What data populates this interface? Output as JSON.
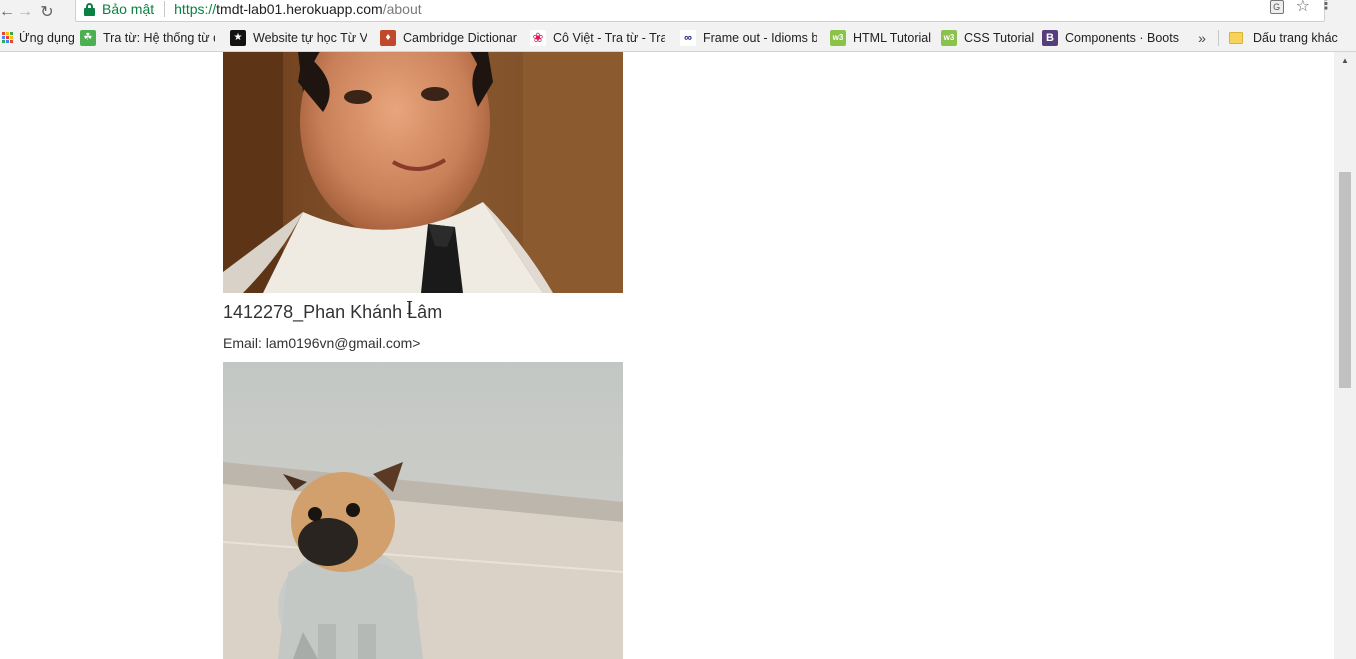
{
  "browser": {
    "secure_label": "Bảo mật",
    "url_scheme": "https://",
    "url_host": "tmdt-lab01.herokuapp.com",
    "url_path": "/about",
    "translate_icon_text": "G"
  },
  "bookmarks": [
    {
      "label": "Ứng dụng",
      "icon": "apps-icon"
    },
    {
      "label": "Tra từ: Hệ thống từ đi",
      "icon": "leaf-icon",
      "color": "#4caf50"
    },
    {
      "label": "Website tự học Từ Vự",
      "icon": "star-icon",
      "color": "#111111"
    },
    {
      "label": "Cambridge Dictionary",
      "icon": "shield-icon",
      "color": "#c0492b"
    },
    {
      "label": "Cô Việt - Tra từ - Tra t",
      "icon": "flame-icon",
      "color": "#d81b60"
    },
    {
      "label": "Frame out - Idioms by",
      "icon": "idioms-icon",
      "color": "#1a237e"
    },
    {
      "label": "HTML Tutorial",
      "icon": "w3-icon",
      "color": "#8bc34a",
      "icon_text": "w3"
    },
    {
      "label": "CSS Tutorial",
      "icon": "w3-icon",
      "color": "#8bc34a",
      "icon_text": "w3"
    },
    {
      "label": "Components · Bootstra",
      "icon": "bootstrap-icon",
      "color": "#563d7c",
      "icon_text": "B"
    }
  ],
  "bookmarks_more": "»",
  "other_bookmarks": "Dấu trang khác",
  "members": [
    {
      "name": "1412278_Phan Khánh Lâm",
      "email": "Email: lam0196vn@gmail.com>"
    }
  ],
  "colors": {
    "secure": "#0b8043",
    "text": "#333333"
  }
}
